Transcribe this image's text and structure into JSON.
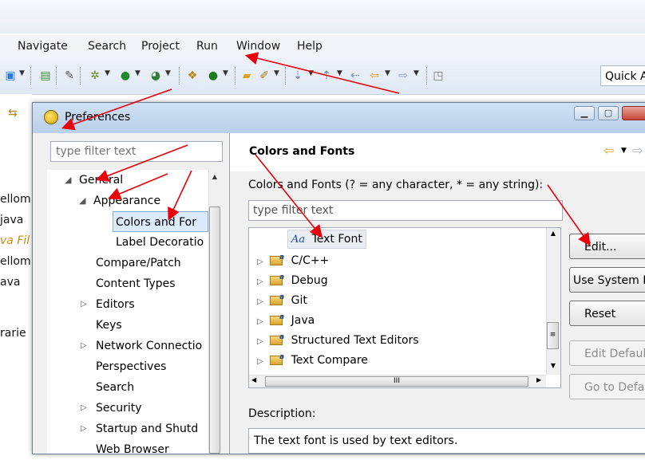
{
  "menubar": {
    "items": [
      "Navigate",
      "Search",
      "Project",
      "Run",
      "Window",
      "Help"
    ]
  },
  "toolbar": {
    "quick_access": "Quick A"
  },
  "background_fragments": [
    "ellom",
    "java",
    "va Fil",
    "ellom",
    "ava",
    "rarie"
  ],
  "dialog": {
    "title": "Preferences",
    "filter_placeholder": "type filter text",
    "tree": [
      {
        "label": "General",
        "expanded": true
      },
      {
        "label": "Appearance",
        "expanded": true
      },
      {
        "label": "Colors and For",
        "selected": true
      },
      {
        "label": "Label Decoratio"
      },
      {
        "label": "Compare/Patch"
      },
      {
        "label": "Content Types"
      },
      {
        "label": "Editors"
      },
      {
        "label": "Keys"
      },
      {
        "label": "Network Connectio"
      },
      {
        "label": "Perspectives"
      },
      {
        "label": "Search"
      },
      {
        "label": "Security"
      },
      {
        "label": "Startup and Shutd"
      },
      {
        "label": "Web Browser"
      }
    ]
  },
  "page": {
    "title": "Colors and Fonts",
    "subtitle": "Colors and Fonts (? = any character, * = any string):",
    "filter_placeholder": "type filter text",
    "tree": [
      {
        "label": "Text Font",
        "badge": "Aa"
      },
      {
        "label": "C/C++"
      },
      {
        "label": "Debug"
      },
      {
        "label": "Git"
      },
      {
        "label": "Java"
      },
      {
        "label": "Structured Text Editors"
      },
      {
        "label": "Text Compare"
      }
    ],
    "buttons": {
      "edit": "Edit...",
      "use_system": "Use System Fo",
      "reset": "Reset",
      "edit_default": "Edit Default",
      "go_to_default": "Go to Defa"
    },
    "description_label": "Description:",
    "description": "The text font is used by text editors."
  },
  "colors": {
    "annotation": "#e8000b",
    "selection": "#dcebfc"
  }
}
